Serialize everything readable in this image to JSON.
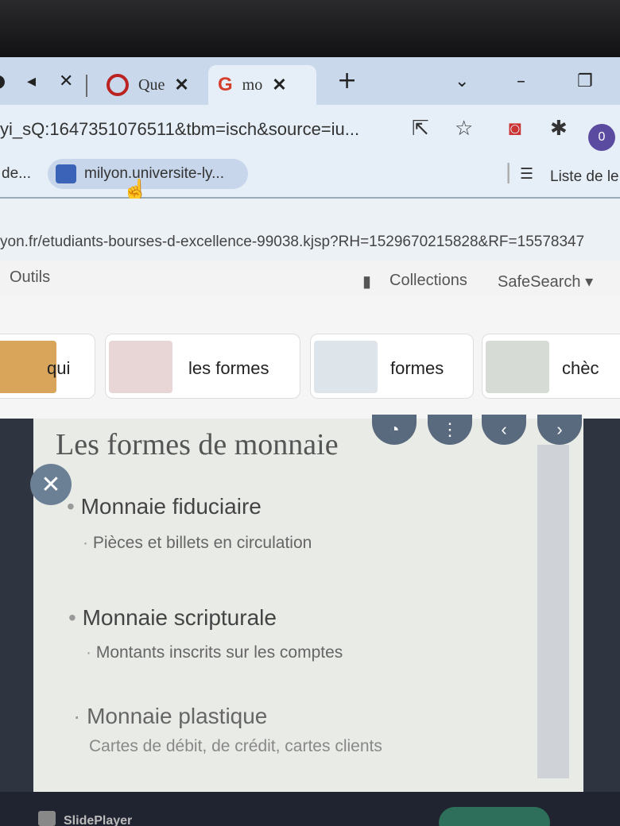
{
  "tabs": [
    {
      "title": "Que",
      "close": "✕"
    },
    {
      "title": "mo",
      "close": "✕"
    }
  ],
  "new_tab": "+",
  "address": {
    "url": "yi_sQ:1647351076511&tbm=isch&source=iu..."
  },
  "profile_initial": "0",
  "bookmarks": {
    "left": "de...",
    "chip_label": "milyon.universite-ly...",
    "reading_list": "Liste de le"
  },
  "status_url": "yon.fr/etudiants-bourses-d-excellence-99038.kjsp?RH=1529670215828&RF=15578347",
  "toolbar": {
    "tools": "Outils",
    "collections": "Collections",
    "safesearch": "SafeSearch ▾"
  },
  "chips": [
    {
      "label": "qui"
    },
    {
      "label": "les formes"
    },
    {
      "label": "formes"
    },
    {
      "label": "chèc"
    }
  ],
  "slide": {
    "title": "Les formes de monnaie",
    "sections": [
      {
        "heading": "Monnaie fiduciaire",
        "detail": "Pièces et billets en circulation"
      },
      {
        "heading": "Monnaie scripturale",
        "detail": "Montants inscrits sur les comptes"
      },
      {
        "heading": "Monnaie plastique",
        "detail": "Cartes de débit, de crédit, cartes clients"
      }
    ]
  },
  "footer": {
    "source": "SlidePlayer"
  },
  "colors": {
    "tab_bg": "#c9d8ea",
    "active_tab": "#e6eff8",
    "slide_bg": "#e9ebe7",
    "overlay_btn": "#5a6a7e"
  }
}
